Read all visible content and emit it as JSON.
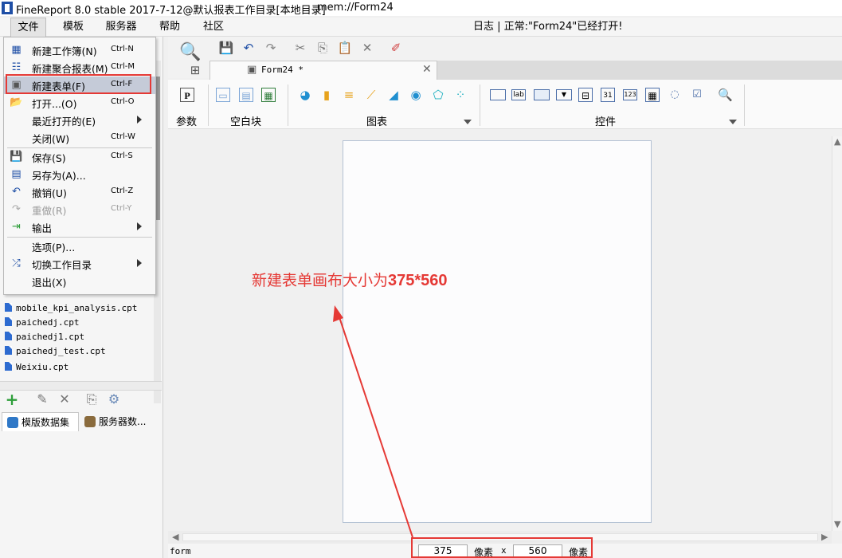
{
  "window": {
    "title": "FineReport 8.0 stable 2017-7-12@默认报表工作目录[本地目录]",
    "path": "mem://Form24"
  },
  "menubar": {
    "items": [
      "文件",
      "模板",
      "服务器",
      "帮助",
      "社区"
    ],
    "status": "日志 | 正常:\"Form24\"已经打开!"
  },
  "file_menu": {
    "items": [
      {
        "label": "新建工作簿(N)",
        "shortcut": "Ctrl-N",
        "icon": "new-workbook-icon"
      },
      {
        "label": "新建聚合报表(M)",
        "shortcut": "Ctrl-M",
        "icon": "new-aggregate-icon"
      },
      {
        "label": "新建表单(F)",
        "shortcut": "Ctrl-F",
        "icon": "new-form-icon"
      },
      {
        "label": "打开...(O)",
        "shortcut": "Ctrl-O",
        "icon": "open-folder-icon"
      },
      {
        "label": "最近打开的(E)",
        "shortcut": "",
        "icon": ""
      },
      {
        "label": "关闭(W)",
        "shortcut": "Ctrl-W",
        "icon": ""
      },
      {
        "label": "保存(S)",
        "shortcut": "Ctrl-S",
        "icon": "save-icon"
      },
      {
        "label": "另存为(A)...",
        "shortcut": "",
        "icon": "save-as-icon"
      },
      {
        "label": "撤销(U)",
        "shortcut": "Ctrl-Z",
        "icon": "undo-icon"
      },
      {
        "label": "重做(R)",
        "shortcut": "Ctrl-Y",
        "icon": "redo-icon"
      },
      {
        "label": "输出",
        "shortcut": "",
        "icon": "export-icon"
      },
      {
        "label": "选项(P)...",
        "shortcut": "",
        "icon": ""
      },
      {
        "label": "切换工作目录",
        "shortcut": "",
        "icon": "switch-dir-icon"
      },
      {
        "label": "退出(X)",
        "shortcut": "",
        "icon": ""
      }
    ]
  },
  "file_tree": [
    "mobile_kpi_analysis.cpt",
    "paichedj.cpt",
    "paichedj1.cpt",
    "paichedj_test.cpt",
    "Weixiu.cpt"
  ],
  "dataset_tabs": [
    "模版数据集",
    "服务器数..."
  ],
  "editor": {
    "tab_label": "Form24 *",
    "groups": {
      "param": "参数",
      "blank": "空白块",
      "chart": "图表",
      "widget": "控件"
    },
    "param_glyph": "P",
    "widget_glyphs": {
      "lab": "lab",
      "date": "31",
      "number": "123"
    },
    "mode": "form",
    "width_value": "375",
    "height_value": "560",
    "unit": "像素",
    "times": "x"
  },
  "annotation": {
    "text": "新建表单画布大小为",
    "size": "375*560"
  },
  "colors": {
    "highlight_red": "#e53935",
    "menu_highlight": "#c5cbd8",
    "icon_blue": "#2d6bd0"
  }
}
